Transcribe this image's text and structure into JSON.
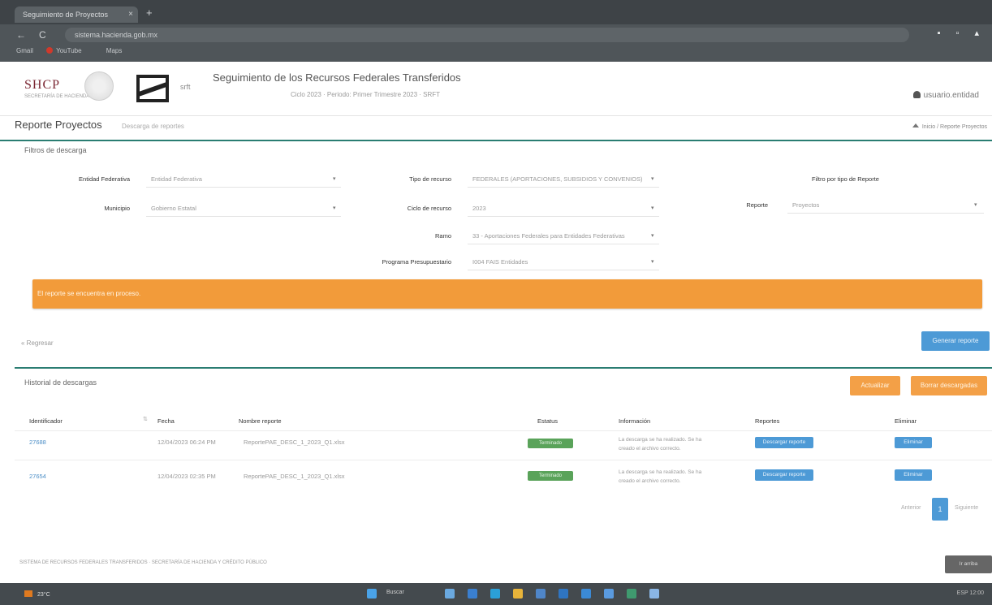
{
  "browser": {
    "tab_title": "Seguimiento de Proyectos",
    "tab_close": "×",
    "new_tab": "+",
    "address": "sistema.hacienda.gob.mx",
    "back": "←",
    "reload": "C",
    "window_controls": "▪ ▫ ▴",
    "bookmarks": [
      "Gmail",
      "YouTube",
      "Maps"
    ]
  },
  "header": {
    "logo_text": "SHCP",
    "logo_subtext": "SECRETARÍA DE HACIENDA",
    "logo_small": "srft",
    "title": "Seguimiento de los Recursos Federales Transferidos",
    "subtitle": "Ciclo 2023 · Periodo: Primer Trimestre 2023 · SRFT",
    "user": "usuario.entidad"
  },
  "page": {
    "title": "Reporte Proyectos",
    "title_sub": "Descarga de reportes",
    "breadcrumb": "Inicio / Reporte Proyectos"
  },
  "filters": {
    "panel_title": "Filtros de descarga",
    "entidad_label": "Entidad Federativa",
    "entidad_value": "Entidad Federativa",
    "municipio_label": "Municipio",
    "municipio_value": "Gobierno Estatal",
    "tipo_label": "Tipo de recurso",
    "tipo_value": "FEDERALES (APORTACIONES, SUBSIDIOS Y CONVENIOS)",
    "ciclo_label": "Ciclo de recurso",
    "ciclo_value": "2023",
    "ramo_label": "Ramo",
    "ramo_value": "33 - Aportaciones Federales para Entidades Federativas",
    "programa_label": "Programa Presupuestario",
    "programa_value": "I004 FAIS Entidades",
    "filtro_tipo_label": "Filtro por tipo de Reporte",
    "reporte_label": "Reporte",
    "reporte_value": "Proyectos",
    "caret": "▾"
  },
  "alert": {
    "text": "El reporte se encuentra en proceso."
  },
  "actions": {
    "back_link": "« Regresar",
    "generate_button": "Generar reporte"
  },
  "history": {
    "title": "Historial de descargas",
    "refresh_button": "Actualizar",
    "delete_all_button": "Borrar descargadas",
    "sort_icon": "⇅",
    "columns": [
      "Identificador",
      "Fecha",
      "Nombre reporte",
      "Estatus",
      "Información",
      "Reportes",
      "Eliminar"
    ],
    "rows": [
      {
        "id": "27688",
        "fecha": "12/04/2023 06:24 PM",
        "nombre": "ReportePAE_DESC_1_2023_Q1.xlsx",
        "estatus": "Terminado",
        "info": "La descarga se ha realizado. Se ha",
        "info2": "creado el archivo correcto.",
        "reporte_btn": "Descargar reporte",
        "eliminar_btn": "Eliminar"
      },
      {
        "id": "27654",
        "fecha": "12/04/2023 02:35 PM",
        "nombre": "ReportePAE_DESC_1_2023_Q1.xlsx",
        "estatus": "Terminado",
        "info": "La descarga se ha realizado. Se ha",
        "info2": "creado el archivo correcto.",
        "reporte_btn": "Descargar reporte",
        "eliminar_btn": "Eliminar"
      }
    ],
    "pager_prev": "Anterior",
    "pager_current": "1",
    "pager_next": "Siguiente"
  },
  "footer": {
    "text": "SISTEMA DE RECURSOS FEDERALES TRANSFERIDOS · SECRETARÍA DE HACIENDA Y CRÉDITO PÚBLICO",
    "button": "Ir arriba"
  },
  "taskbar": {
    "weather": "23°C",
    "search": "Buscar",
    "tray": "ESP 12:00"
  },
  "colors": {
    "accent_teal": "#2a7d72",
    "alert_orange": "#f29b3a",
    "primary_blue": "#4d9ad6",
    "success_green": "#5aa35a"
  }
}
